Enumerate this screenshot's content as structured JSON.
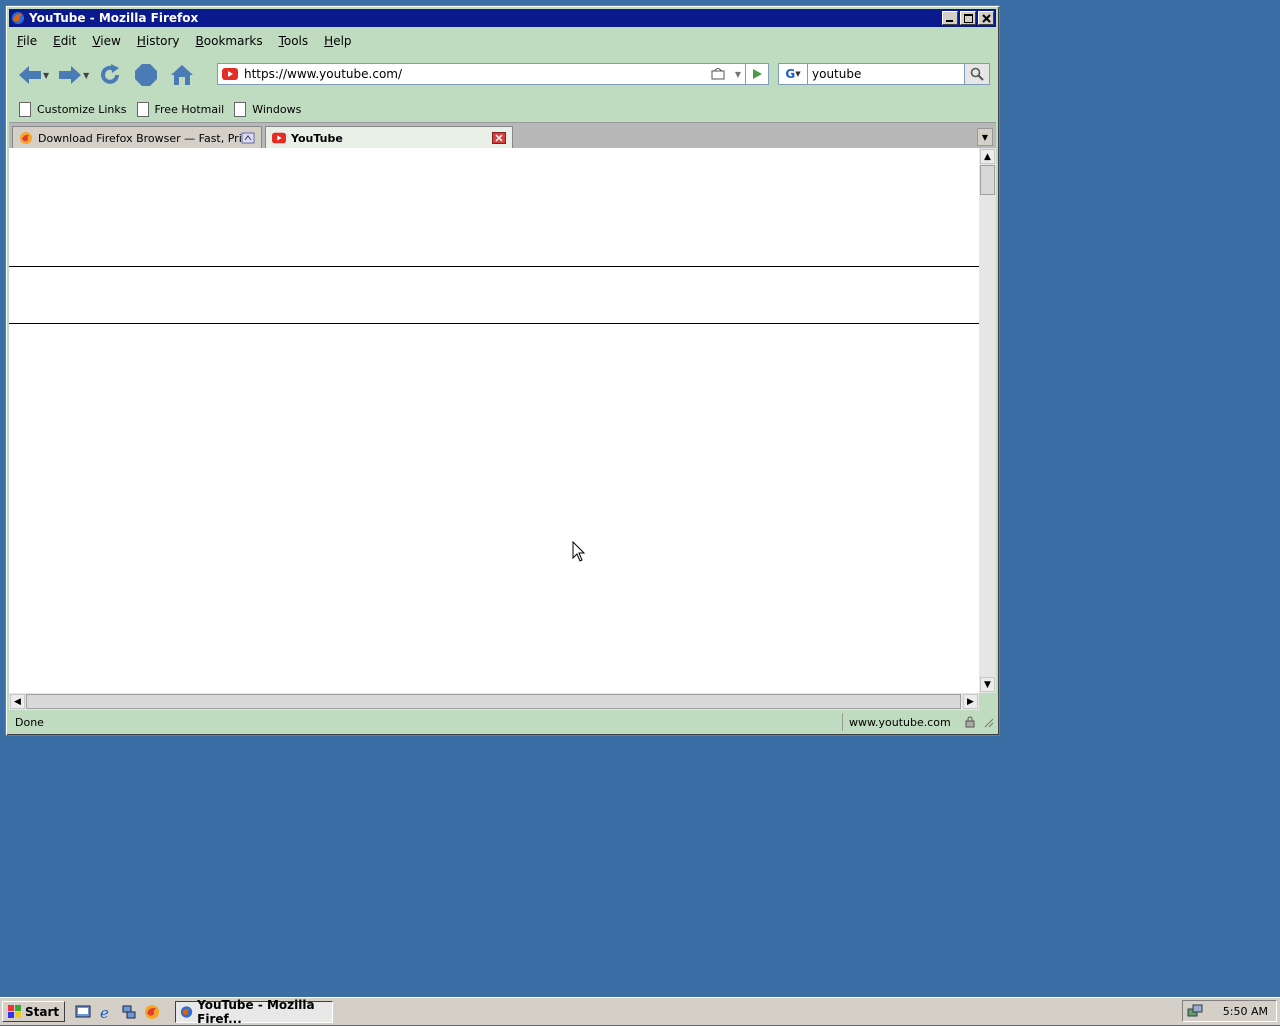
{
  "window": {
    "title": "YouTube - Mozilla Firefox"
  },
  "menu": [
    "File",
    "Edit",
    "View",
    "History",
    "Bookmarks",
    "Tools",
    "Help"
  ],
  "menu_accel": [
    "F",
    "E",
    "V",
    "H",
    "B",
    "T",
    "H"
  ],
  "navigation": {
    "url": "https://www.youtube.com/",
    "search_engine_letter": "G",
    "search_text": "youtube"
  },
  "bookmarks": [
    "Customize Links",
    "Free Hotmail",
    "Windows"
  ],
  "tabs": [
    {
      "label": "Download Firefox Browser — Fast, Pri...",
      "active": false
    },
    {
      "label": "YouTube",
      "active": true
    }
  ],
  "status": {
    "text": "Done",
    "domain": "www.youtube.com"
  },
  "taskbar": {
    "start_label": "Start",
    "task_label": "YouTube - Mozilla Firef...",
    "clock": "5:50 AM"
  },
  "colors": {
    "desktop": "#3a6ea5",
    "chrome": "#c0dcc0",
    "titlebar": "#0a1a8c"
  }
}
